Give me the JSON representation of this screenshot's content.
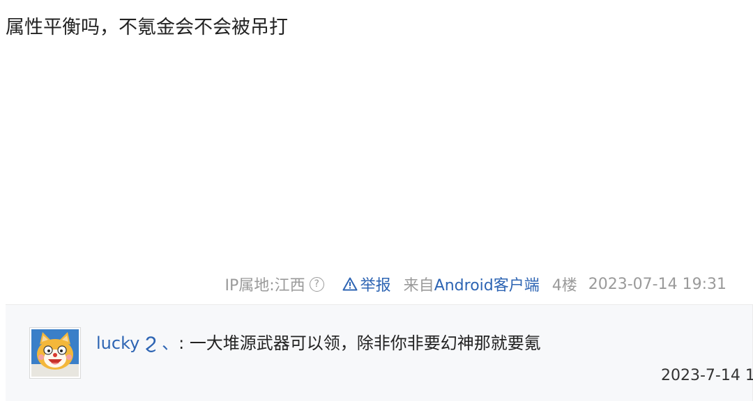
{
  "post": {
    "text": "属性平衡吗，不氪金会不会被吊打"
  },
  "meta": {
    "ip_location": "IP属地:江西",
    "ip_help_glyph": "?",
    "report_label": "举报",
    "from_prefix": "来自",
    "from_client": "Android客户端",
    "floor": "4楼",
    "timestamp": "2023-07-14 19:31"
  },
  "comment": {
    "username": "lucky",
    "username_suffix": "Ϩ 、",
    "separator": ":",
    "text": "一大堆源武器可以领，除非你非要幻神那就要氪",
    "time": "2023-7-14 1"
  },
  "colors": {
    "link": "#2d64b3",
    "muted": "#9a9a9a",
    "panel_bg": "#f7f8fa",
    "avatar_bg": "#3a7fc8",
    "avatar_face": "#f3b73b"
  },
  "icons": {
    "report": "warning-triangle-icon",
    "help": "question-circle-icon",
    "avatar": "cartoon-cat-avatar"
  }
}
